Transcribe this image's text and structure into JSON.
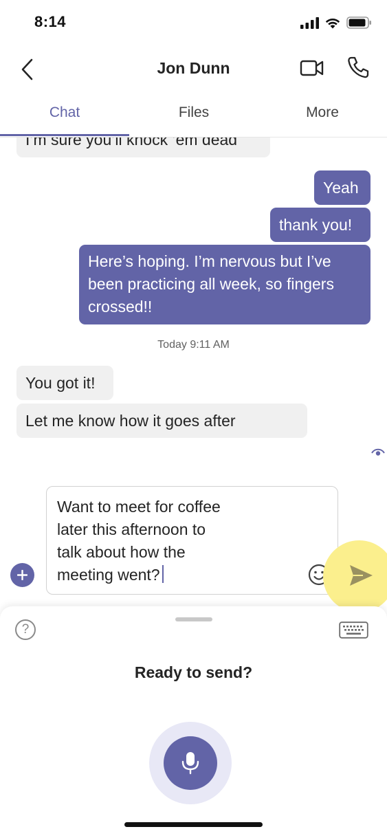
{
  "status_bar": {
    "time": "8:14"
  },
  "header": {
    "title": "Jon Dunn"
  },
  "tabs": [
    {
      "label": "Chat",
      "active": true
    },
    {
      "label": "Files",
      "active": false
    },
    {
      "label": "More",
      "active": false
    }
  ],
  "messages": {
    "m0": "I’m sure you’ll knock ’em dead",
    "m1": "Yeah",
    "m2": "thank you!",
    "m3": "Here’s hoping. I’m nervous but I’ve been practicing all week, so fingers crossed!!",
    "timestamp": "Today 9:11 AM",
    "m4": "You got it!",
    "m5": "Let me know how it goes after"
  },
  "composer": {
    "text": "Want to meet for coffee\nlater this afternoon to\ntalk about how the\nmeeting went?"
  },
  "sheet": {
    "prompt": "Ready to send?",
    "help_glyph": "?"
  },
  "colors": {
    "accent": "#6264a7",
    "incoming_bubble": "#f0f0f0",
    "send_highlight": "#fbef8d",
    "mic_ring": "#e8e8f6"
  },
  "icons": [
    "signal-icon",
    "wifi-icon",
    "battery-icon",
    "back-icon",
    "video-call-icon",
    "phone-call-icon",
    "seen-icon",
    "add-icon",
    "emoji-icon",
    "send-icon",
    "help-icon",
    "keyboard-icon",
    "microphone-icon"
  ]
}
